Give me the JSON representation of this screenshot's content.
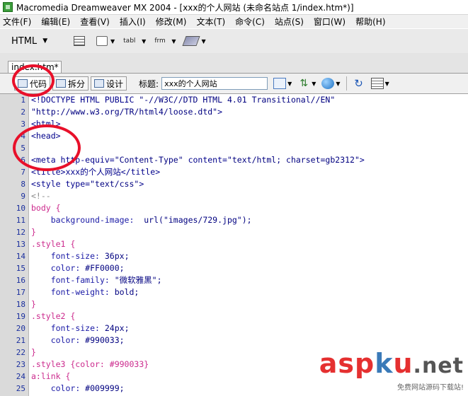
{
  "window": {
    "title": "Macromedia Dreamweaver MX 2004 - [xxx的个人网站 (未命名站点 1/index.htm*)]"
  },
  "menubar": {
    "items": [
      "文件(F)",
      "编辑(E)",
      "查看(V)",
      "插入(I)",
      "修改(M)",
      "文本(T)",
      "命令(C)",
      "站点(S)",
      "窗口(W)",
      "帮助(H)"
    ]
  },
  "insert_bar": {
    "category": "HTML",
    "tabl_label": "tabl",
    "frm_label": "frm"
  },
  "document_tab": {
    "label": "index.htm*"
  },
  "doc_toolbar": {
    "code_label": "代码",
    "split_label": "拆分",
    "design_label": "设计",
    "title_label": "标题:",
    "title_value": "xxx的个人网站"
  },
  "code": {
    "lines": [
      {
        "n": "1",
        "text": "<!DOCTYPE HTML PUBLIC \"-//W3C//DTD HTML 4.01 Transitional//EN\""
      },
      {
        "n": "2",
        "text": "\"http://www.w3.org/TR/html4/loose.dtd\">"
      },
      {
        "n": "3",
        "text": "<html>"
      },
      {
        "n": "4",
        "text": "<head>"
      },
      {
        "n": "5",
        "text": ""
      },
      {
        "n": "6",
        "text": "<meta http-equiv=\"Content-Type\" content=\"text/html; charset=gb2312\">"
      },
      {
        "n": "7",
        "text": "<title>xxx的个人网站</title>"
      },
      {
        "n": "8",
        "text": "<style type=\"text/css\">"
      },
      {
        "n": "9",
        "text": "<!--"
      },
      {
        "n": "10",
        "text": "body {"
      },
      {
        "n": "11",
        "text": "    background-image:  url(\"images/729.jpg\");"
      },
      {
        "n": "12",
        "text": "}"
      },
      {
        "n": "13",
        "text": ".style1 {"
      },
      {
        "n": "14",
        "text": "    font-size: 36px;"
      },
      {
        "n": "15",
        "text": "    color: #FF0000;"
      },
      {
        "n": "16",
        "text": "    font-family: \"微软雅黑\";"
      },
      {
        "n": "17",
        "text": "    font-weight: bold;"
      },
      {
        "n": "18",
        "text": "}"
      },
      {
        "n": "19",
        "text": ".style2 {"
      },
      {
        "n": "20",
        "text": "    font-size: 24px;"
      },
      {
        "n": "21",
        "text": "    color: #990033;"
      },
      {
        "n": "22",
        "text": "}"
      },
      {
        "n": "23",
        "text": ".style3 {color: #990033}"
      },
      {
        "n": "24",
        "text": "a:link {"
      },
      {
        "n": "25",
        "text": "    color: #009999;"
      }
    ]
  },
  "watermark": {
    "asp": "asp",
    "k": "k",
    "u": "u",
    "net": ".net",
    "subtitle": "免费网站源码下载站!"
  },
  "colors": {
    "annotation_red": "#e8102a",
    "code_tag": "#00008b",
    "code_selector": "#cc2a8d",
    "gutter_number": "#1a2f9e"
  }
}
